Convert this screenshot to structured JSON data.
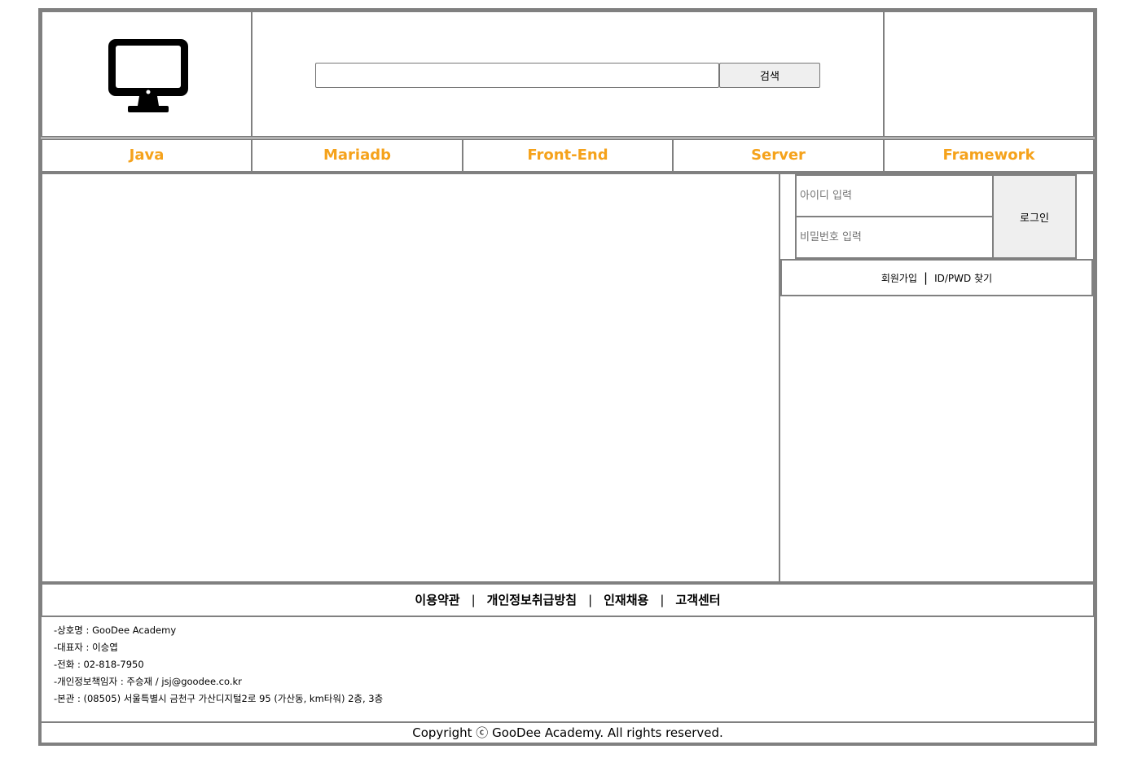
{
  "header": {
    "logo_icon": "monitor-icon",
    "search": {
      "value": "",
      "placeholder": "",
      "button_label": "검색"
    }
  },
  "nav": {
    "color": "#f5a21b",
    "items": [
      "Java",
      "Mariadb",
      "Front-End",
      "Server",
      "Framework"
    ]
  },
  "login": {
    "id_placeholder": "아이디 입력",
    "pw_placeholder": "비밀번호 입력",
    "button_label": "로그인",
    "signup_link": "회원가입",
    "separator": "|",
    "find_link": "ID/PWD 찾기"
  },
  "footer": {
    "links": [
      "이용약관",
      "개인정보취급방침",
      "인재채용",
      "고객센터"
    ],
    "separator": "|",
    "info": [
      "-상호명 : GooDee Academy",
      "-대표자 : 이승엽",
      "-전화 : 02-818-7950",
      "-개인정보책임자 : 주승재 / jsj@goodee.co.kr",
      "-본관 : (08505) 서울특별시 금천구 가산디지털2로 95 (가산동, km타워) 2층, 3층"
    ],
    "copyright": "Copyright ⓒ GooDee Academy. All rights reserved."
  }
}
